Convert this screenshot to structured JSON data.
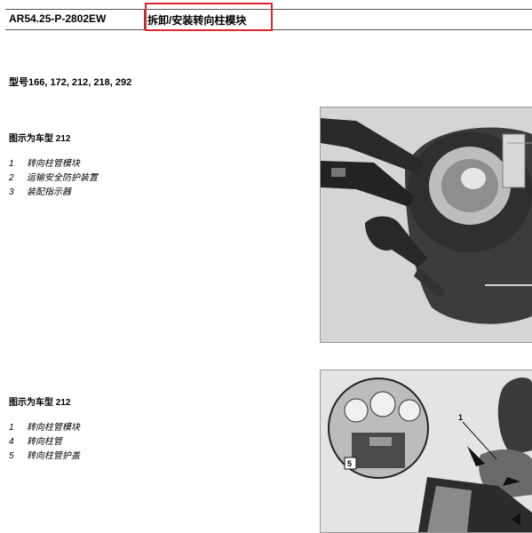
{
  "header": {
    "doc_code": "AR54.25-P-2802EW",
    "title": "拆卸/安装转向柱模块"
  },
  "models": "型号166, 172, 212, 218, 292",
  "figures": [
    {
      "caption": "图示为车型 212",
      "legend": [
        {
          "num": "1",
          "text": "转向柱管模块"
        },
        {
          "num": "2",
          "text": "运输安全防护装置"
        },
        {
          "num": "3",
          "text": "装配指示器"
        }
      ]
    },
    {
      "caption": "图示为车型 212",
      "legend": [
        {
          "num": "1",
          "text": "转向柱管模块"
        },
        {
          "num": "4",
          "text": "转向柱管"
        },
        {
          "num": "5",
          "text": "转向柱管护盖"
        }
      ],
      "callouts": [
        "1",
        "5"
      ]
    }
  ],
  "colors": {
    "highlight": "#e0262d"
  }
}
